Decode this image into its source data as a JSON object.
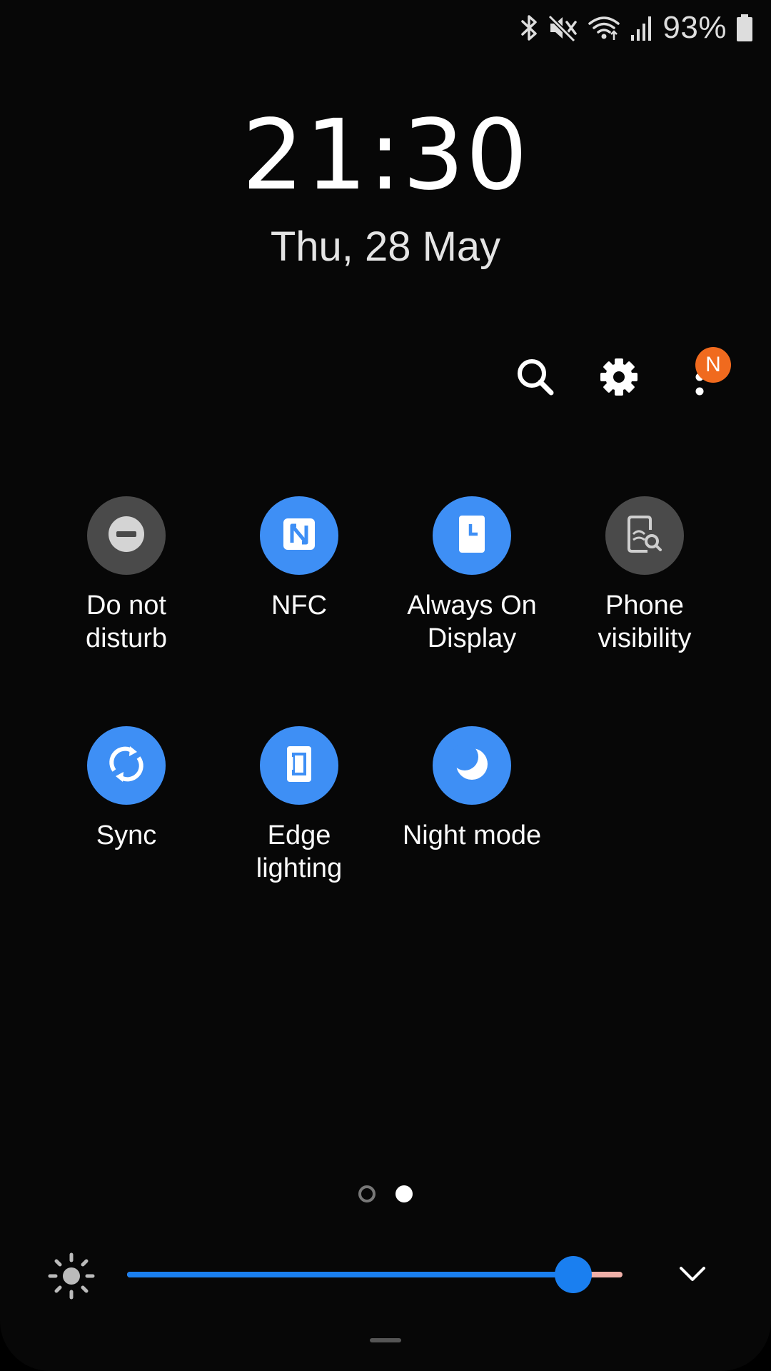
{
  "status_bar": {
    "battery_percent": "93%",
    "icons": [
      "bluetooth-icon",
      "mute-icon",
      "wifi-icon",
      "signal-icon",
      "battery-icon"
    ]
  },
  "clock": {
    "time": "21:30",
    "date": "Thu, 28 May"
  },
  "actions": {
    "icons": [
      "search-icon",
      "gear-icon",
      "more-icon"
    ],
    "notification_badge": "N",
    "badge_color": "#f06a1e"
  },
  "tiles": [
    {
      "label": "Do not\ndisturb",
      "icon": "do-not-disturb-icon",
      "state": "off"
    },
    {
      "label": "NFC",
      "icon": "nfc-icon",
      "state": "on"
    },
    {
      "label": "Always On\nDisplay",
      "icon": "always-on-display-icon",
      "state": "on"
    },
    {
      "label": "Phone\nvisibility",
      "icon": "phone-visibility-icon",
      "state": "off"
    },
    {
      "label": "Sync",
      "icon": "sync-icon",
      "state": "on"
    },
    {
      "label": "Edge\nlighting",
      "icon": "edge-lighting-icon",
      "state": "on"
    },
    {
      "label": "Night mode",
      "icon": "night-mode-icon",
      "state": "on"
    }
  ],
  "pagination": {
    "current_page": 2,
    "total_pages": 2
  },
  "brightness": {
    "level": 0.9,
    "icon": "brightness-icon"
  },
  "colors": {
    "tile_on": "#3e8ff5",
    "tile_off": "#4a4a4a",
    "slider": "#1a7ff0",
    "slider_rest": "#f0b0a8"
  }
}
